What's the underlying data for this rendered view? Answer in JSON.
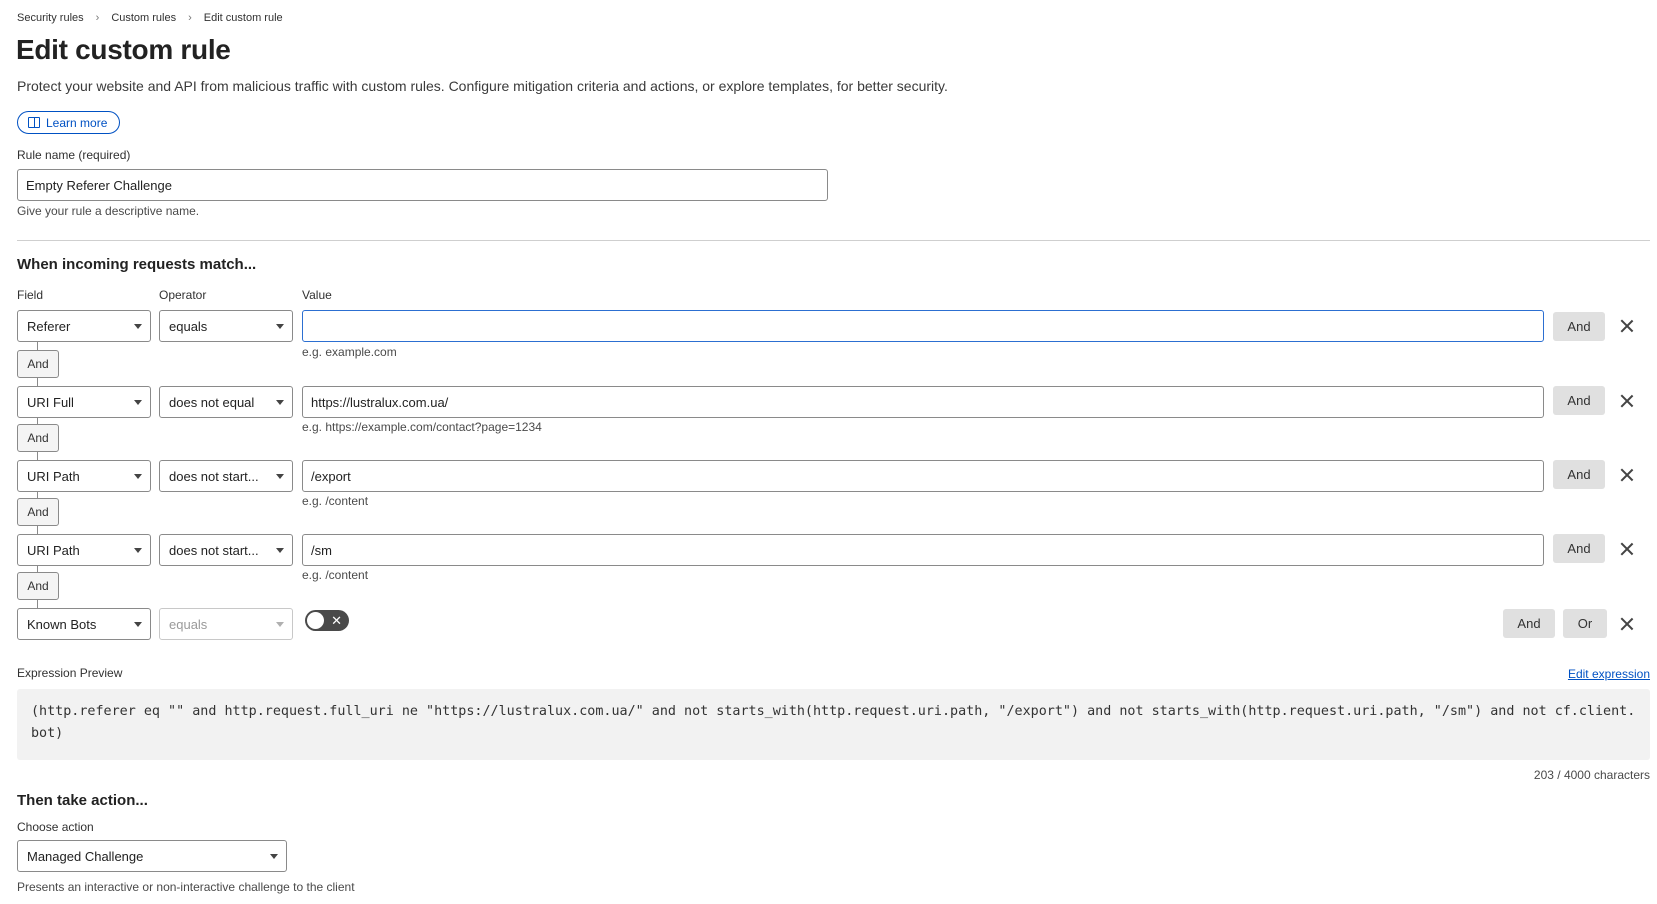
{
  "breadcrumb": {
    "items": [
      "Security rules",
      "Custom rules",
      "Edit custom rule"
    ],
    "separator": "›"
  },
  "page": {
    "title": "Edit custom rule",
    "description": "Protect your website and API from malicious traffic with custom rules. Configure mitigation criteria and actions, or explore templates, for better security.",
    "learn_more": "Learn more"
  },
  "rule_name": {
    "label": "Rule name (required)",
    "value": "Empty Referer Challenge",
    "hint": "Give your rule a descriptive name."
  },
  "match": {
    "title": "When incoming requests match...",
    "headers": {
      "field": "Field",
      "operator": "Operator",
      "value": "Value"
    },
    "connector_label": "And",
    "and_label": "And",
    "or_label": "Or",
    "conditions": [
      {
        "field": "Referer",
        "operator": "equals",
        "value": "",
        "hint": "e.g. example.com"
      },
      {
        "field": "URI Full",
        "operator": "does not equal",
        "value": "https://lustralux.com.ua/",
        "hint": "e.g. https://example.com/contact?page=1234"
      },
      {
        "field": "URI Path",
        "operator": "does not start...",
        "value": "/export",
        "hint": "e.g. /content"
      },
      {
        "field": "URI Path",
        "operator": "does not start...",
        "value": "/sm",
        "hint": "e.g. /content"
      },
      {
        "field": "Known Bots",
        "operator": "equals",
        "toggle_on": false
      }
    ]
  },
  "expression": {
    "label": "Expression Preview",
    "edit_link": "Edit expression",
    "code": "(http.referer eq \"\" and http.request.full_uri ne \"https://lustralux.com.ua/\" and not starts_with(http.request.uri.path, \"/export\") and not starts_with(http.request.uri.path, \"/sm\") and not cf.client.bot)",
    "char_count": "203 / 4000 characters"
  },
  "action": {
    "title": "Then take action...",
    "label": "Choose action",
    "selected": "Managed Challenge",
    "hint": "Presents an interactive or non-interactive challenge to the client"
  },
  "colors": {
    "accent": "#0051c3",
    "focus_border": "#2c6fd1"
  }
}
